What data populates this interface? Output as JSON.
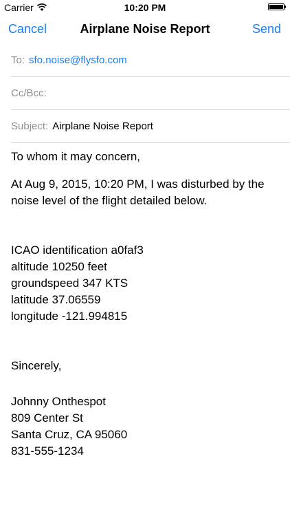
{
  "status_bar": {
    "carrier": "Carrier",
    "time": "10:20 PM"
  },
  "nav": {
    "cancel_label": "Cancel",
    "title": "Airplane Noise Report",
    "send_label": "Send"
  },
  "fields": {
    "to_label": "To:",
    "to_value": "sfo.noise@flysfo.com",
    "cc_label": "Cc/Bcc:",
    "subject_label": "Subject:",
    "subject_value": "Airplane Noise Report"
  },
  "body": {
    "greeting": "To whom it may concern,",
    "intro_line1": "At Aug 9, 2015, 10:20 PM, I was disturbed by the",
    "intro_line2": "noise level of the flight detailed below.",
    "details": [
      "ICAO identification a0faf3",
      "altitude 10250 feet",
      "groundspeed 347 KTS",
      "latitude 37.06559",
      "longitude -121.994815"
    ],
    "closing": "Sincerely,",
    "signature": [
      "Johnny Onthespot",
      "809 Center St",
      "Santa Cruz, CA 95060",
      "831-555-1234"
    ]
  }
}
